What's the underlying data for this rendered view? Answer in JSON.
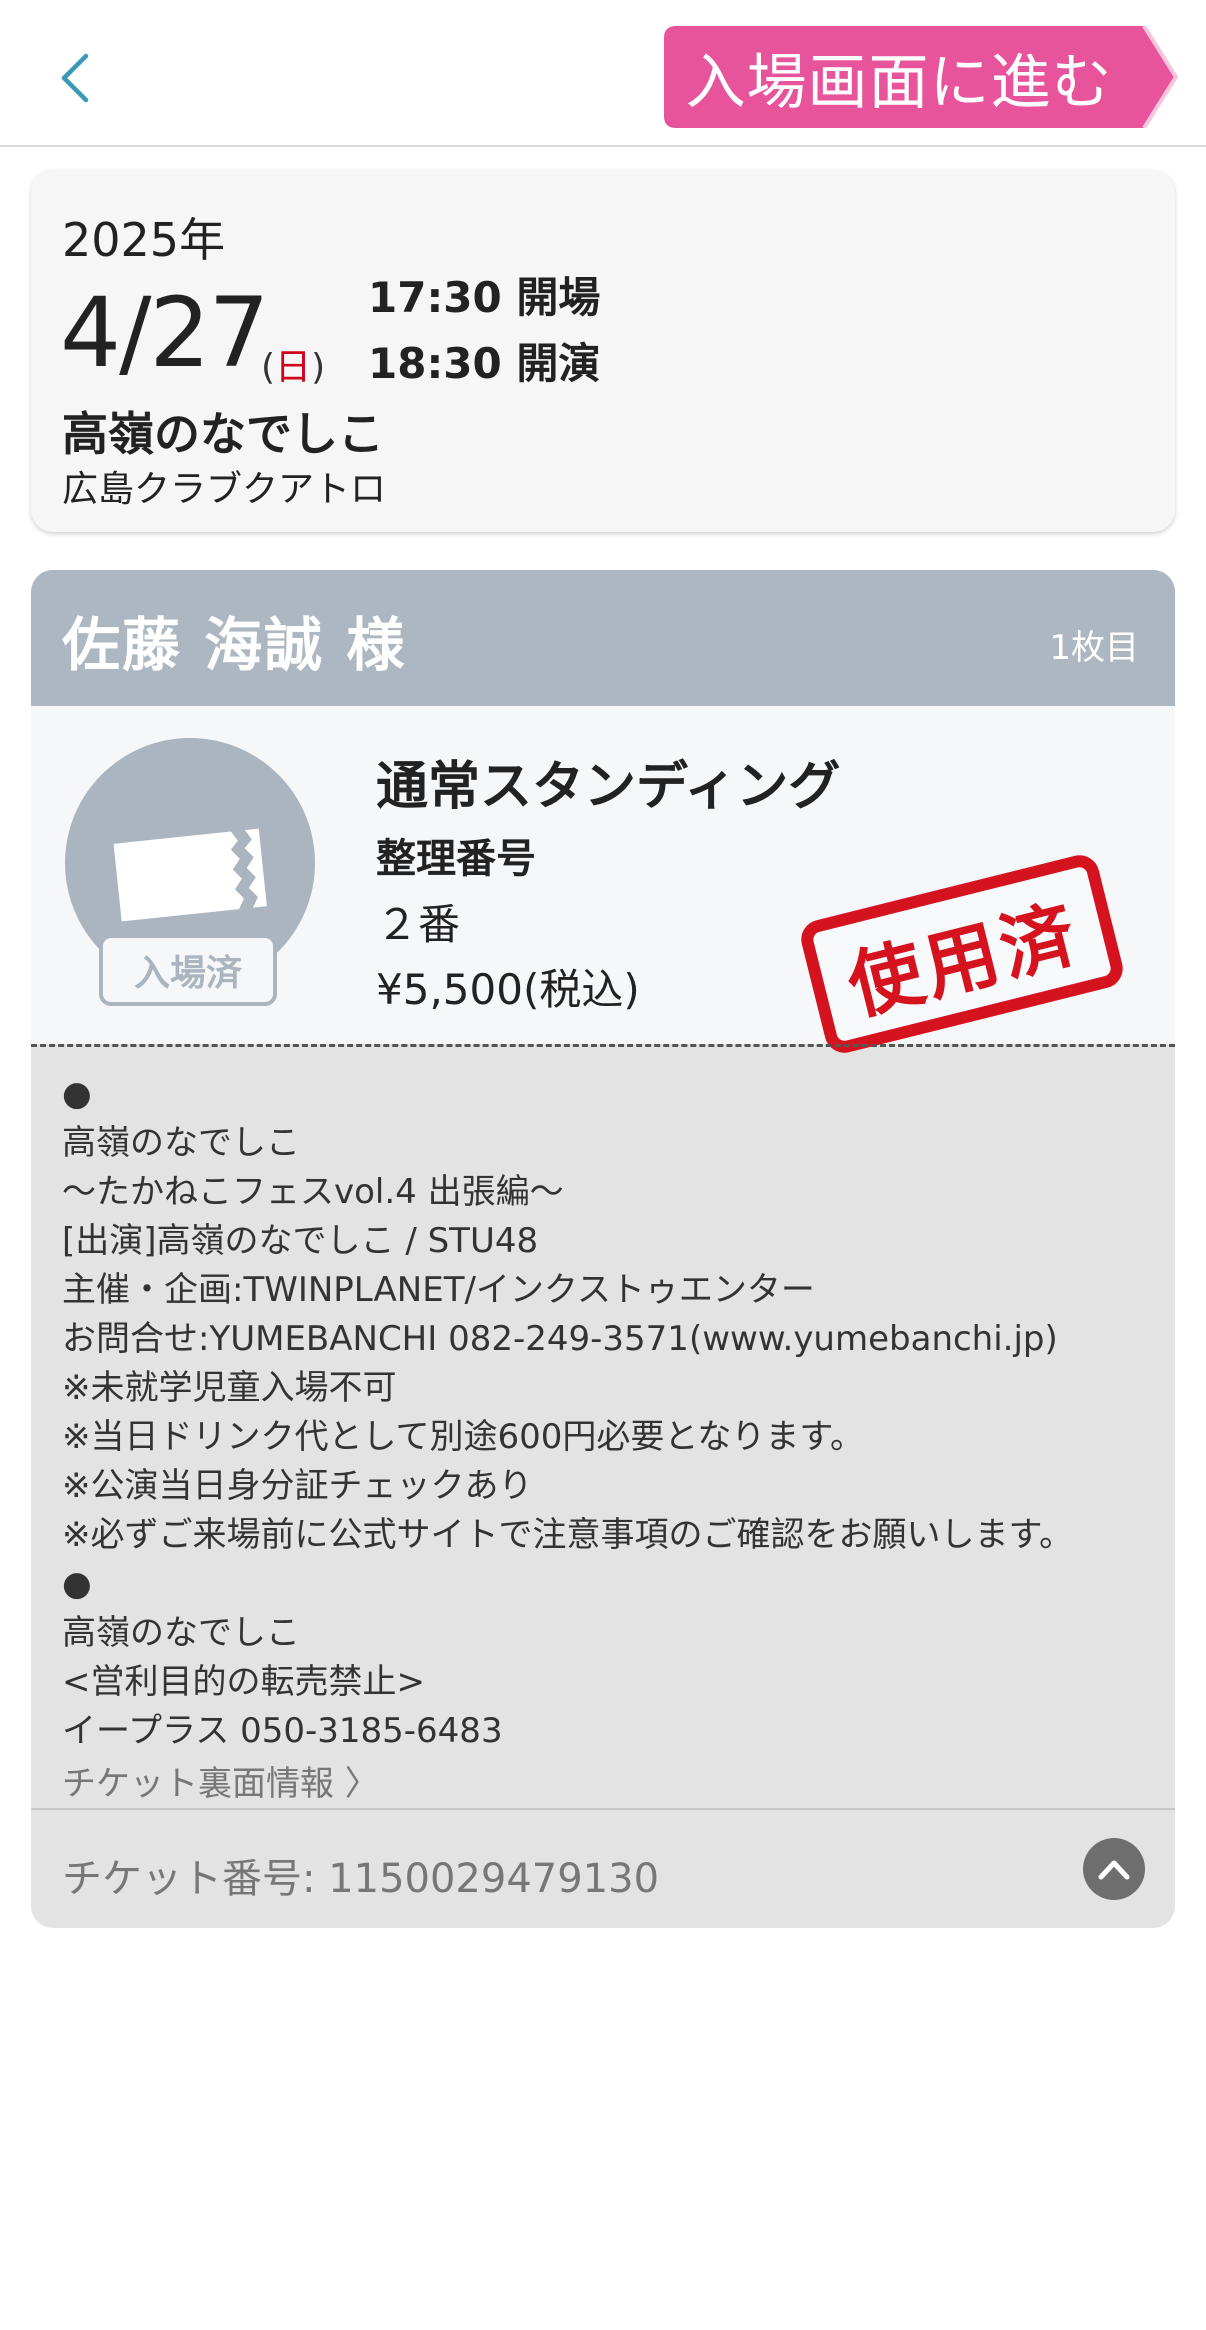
{
  "header": {
    "enter_button_label": "入場画面に進む",
    "accent_color": "#e8549b",
    "back_icon": "chevron-left-icon"
  },
  "event": {
    "year": "2025年",
    "date": "4/27",
    "dow_open": "(",
    "dow": "日",
    "dow_close": ")",
    "open_time": "17:30 開場",
    "start_time": "18:30 開演",
    "artist": "高嶺のなでしこ",
    "venue": "広島クラブクアトロ"
  },
  "ticket": {
    "holder": "佐藤 海誠 様",
    "sheet_label": "1枚目",
    "seat_type": "通常スタンディング",
    "seat_label": "整理番号",
    "seat_number": "２番",
    "price": "¥5,500(税込)",
    "entered_badge": "入場済",
    "used_stamp": "使用済",
    "info_lines": [
      "●",
      "高嶺のなでしこ",
      "〜たかねこフェスvol.4 出張編〜",
      "[出演]高嶺のなでしこ / STU48",
      "主催・企画:TWINPLANET/インクストゥエンター",
      "お問合せ:YUMEBANCHI 082-249-3571(www.yumebanchi.jp)",
      "※未就学児童入場不可",
      "※当日ドリンク代として別途600円必要となります。",
      "※公演当日身分証チェックあり",
      "※必ずご来場前に公式サイトで注意事項のご確認をお願いします。",
      "●",
      "高嶺のなでしこ",
      "<営利目的の転売禁止>",
      "イープラス 050-3185-6483"
    ],
    "back_info_link": "チケット裏面情報 〉",
    "ticket_number": "チケット番号: 1150029479130"
  }
}
